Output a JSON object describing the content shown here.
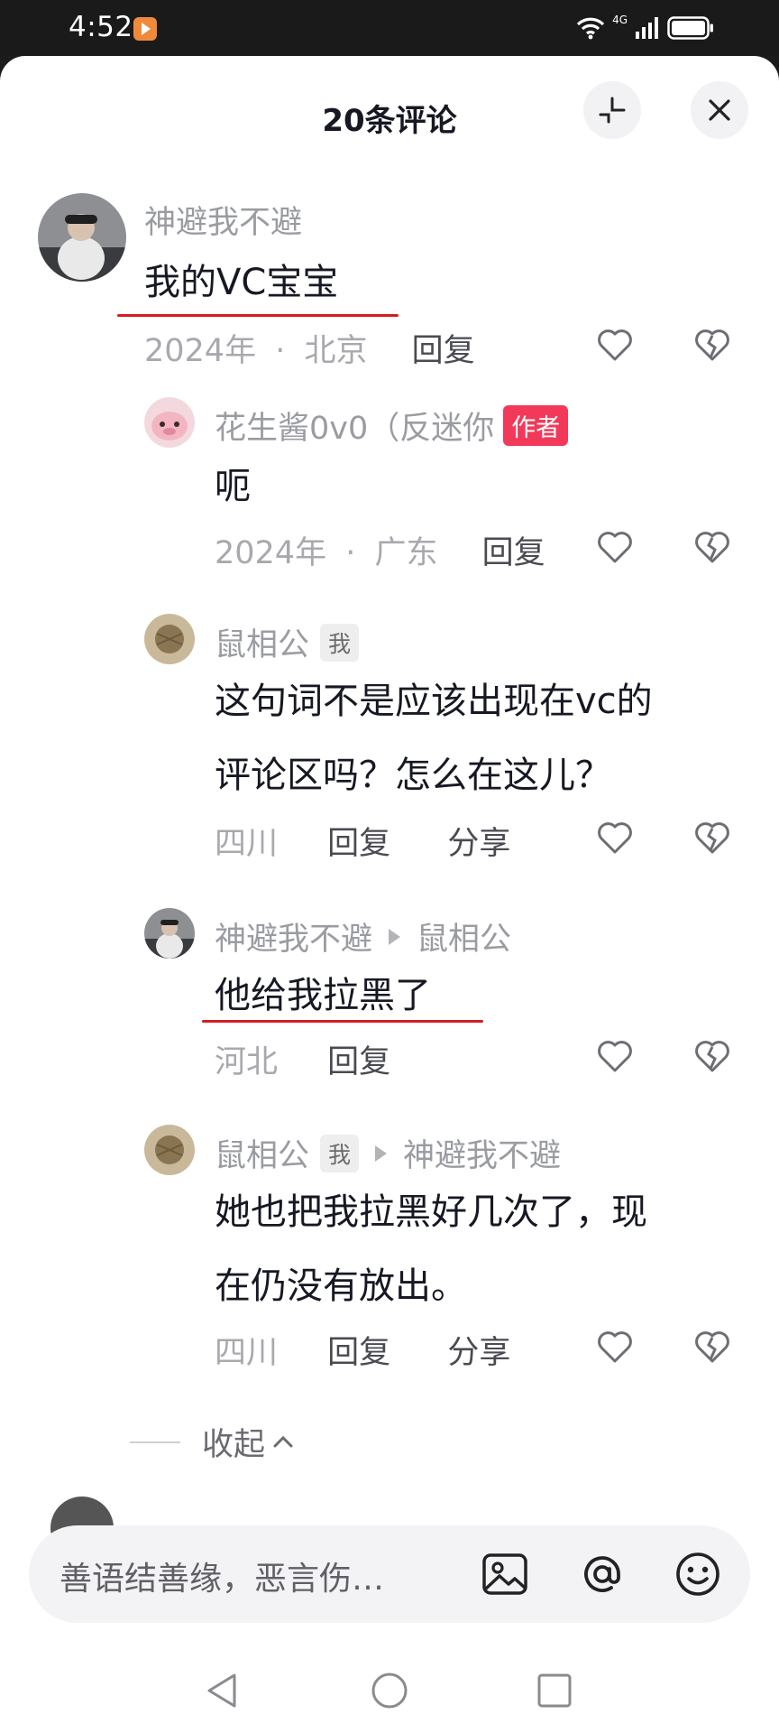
{
  "status_bar": {
    "time": "4:52",
    "network": "4G"
  },
  "header": {
    "title": "20条评论"
  },
  "comments": [
    {
      "author": "神避我不避",
      "content": "我的VC宝宝",
      "year": "2024年",
      "location": "北京",
      "reply_label": "回复"
    }
  ],
  "replies": [
    {
      "author": "花生酱0v0（反迷你",
      "badge": "作者",
      "content": "呃",
      "year": "2024年",
      "location": "广东",
      "reply_label": "回复"
    },
    {
      "author": "鼠相公",
      "badge": "我",
      "content": "这句词不是应该出现在vc的\n评论区吗？怎么在这儿？",
      "location": "四川",
      "reply_label": "回复",
      "share_label": "分享"
    },
    {
      "author": "神避我不避",
      "reply_to": "鼠相公",
      "content": "他给我拉黑了",
      "location": "河北",
      "reply_label": "回复"
    },
    {
      "author": "鼠相公",
      "badge": "我",
      "reply_to": "神避我不避",
      "content": "她也把我拉黑好几次了，现\n在仍没有放出。",
      "location": "四川",
      "reply_label": "回复",
      "share_label": "分享"
    }
  ],
  "separator": "·",
  "collapse_label": "收起",
  "input": {
    "placeholder": "善语结善缘，恶言伤…"
  },
  "icons": {
    "collapse": "minimize-icon",
    "close": "close-icon",
    "like": "heart-outline-icon",
    "dislike": "broken-heart-icon",
    "image": "image-icon",
    "mention": "at-icon",
    "emoji": "emoji-icon",
    "nav": [
      "back-triangle-icon",
      "home-circle-icon",
      "recents-square-icon"
    ]
  },
  "colors": {
    "author_badge": "#f2395a",
    "underline": "#d61b22",
    "text_primary": "#161823",
    "text_secondary": "#9a9ca2"
  }
}
